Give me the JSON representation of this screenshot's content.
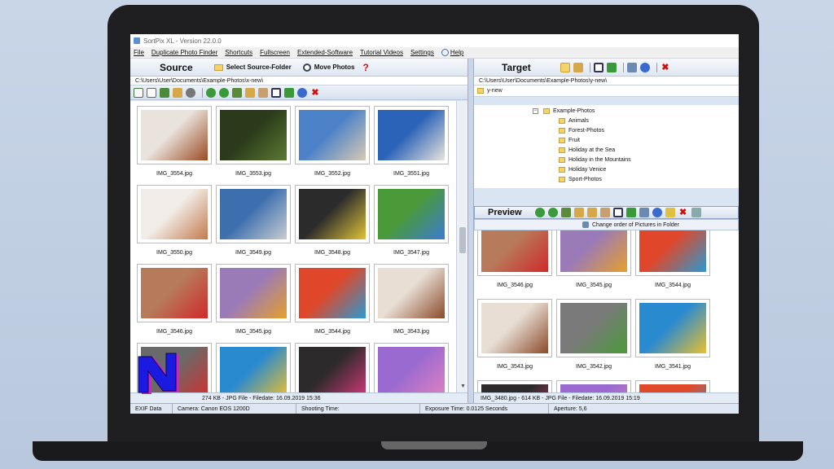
{
  "window": {
    "title": "SortPix XL - Version 22.0.0"
  },
  "menu": [
    "File",
    "Duplicate Photo Finder",
    "Shortcuts",
    "Fullscreen",
    "Extended-Software",
    "Tutorial Videos",
    "Settings",
    "Help"
  ],
  "source": {
    "title": "Source",
    "select_folder_label": "Select Source-Folder",
    "move_label": "Move Photos",
    "help_glyph": "?",
    "path": "C:\\Users\\User\\Documents\\Example-Photos\\x-new\\",
    "thumbnails": [
      {
        "label": "IMG_3554.jpg",
        "colors": [
          "#e9e3dc",
          "#9a4a22"
        ]
      },
      {
        "label": "IMG_3553.jpg",
        "colors": [
          "#2a3a1a",
          "#5c7a34"
        ]
      },
      {
        "label": "IMG_3552.jpg",
        "colors": [
          "#4c82c8",
          "#d8c9b2"
        ]
      },
      {
        "label": "IMG_3551.jpg",
        "colors": [
          "#2b63b8",
          "#e8e4dc"
        ]
      },
      {
        "label": "IMG_3550.jpg",
        "colors": [
          "#f2ede8",
          "#c37a4e"
        ]
      },
      {
        "label": "IMG_3549.jpg",
        "colors": [
          "#3d6fae",
          "#c9ccd2"
        ]
      },
      {
        "label": "IMG_3548.jpg",
        "colors": [
          "#2b2b2b",
          "#e0c438"
        ]
      },
      {
        "label": "IMG_3547.jpg",
        "colors": [
          "#4a9a3a",
          "#3c7bd0"
        ]
      },
      {
        "label": "IMG_3546.jpg",
        "colors": [
          "#b77a5a",
          "#d02a2a"
        ]
      },
      {
        "label": "IMG_3545.jpg",
        "colors": [
          "#9b7ab8",
          "#e5a02a"
        ]
      },
      {
        "label": "IMG_3544.jpg",
        "colors": [
          "#e0472a",
          "#2a9ad0"
        ]
      },
      {
        "label": "IMG_3543.jpg",
        "colors": [
          "#e8ded4",
          "#8a4a2a"
        ]
      },
      {
        "label": "",
        "colors": [
          "#6a6a6a",
          "#d03030"
        ]
      },
      {
        "label": "",
        "colors": [
          "#2a8ad0",
          "#e8c030"
        ]
      },
      {
        "label": "",
        "colors": [
          "#2c2a2a",
          "#d03a7a"
        ]
      },
      {
        "label": "",
        "colors": [
          "#9a6ad0",
          "#e080c0"
        ]
      }
    ],
    "status": "IMG_3554.jpg - 274 KB - JPG File - Filedate: 16.09.2019 15:36",
    "status_visible": "274 KB - JPG File - Filedate: 16.09.2019 15:36"
  },
  "target": {
    "title": "Target",
    "path": "C:\\Users\\User\\Documents\\Example-Photos\\y-new\\",
    "folder_field": "y-new",
    "tree_root": "Example-Photos",
    "tree_items": [
      "Animals",
      "Forest-Photos",
      "Fruit",
      "Holiday at the Sea",
      "Holiday in the Mountains",
      "Holiday Venice",
      "Sport-Photos"
    ],
    "status": "IMG_3480.jpg - 614 KB - JPG File - Filedate: 16.09.2019 15:19"
  },
  "preview": {
    "title": "Preview",
    "change_order_label": "Change order of Pictures in Folder",
    "thumbnails": [
      {
        "label": "IMG_3546.jpg",
        "colors": [
          "#b77a5a",
          "#d02a2a"
        ]
      },
      {
        "label": "IMG_3545.jpg",
        "colors": [
          "#9b7ab8",
          "#e5a02a"
        ]
      },
      {
        "label": "IMG_3544.jpg",
        "colors": [
          "#e0472a",
          "#2a9ad0"
        ]
      },
      {
        "label": "IMG_3543.jpg",
        "colors": [
          "#e8ded4",
          "#8a4a2a"
        ]
      },
      {
        "label": "IMG_3542.jpg",
        "colors": [
          "#7a7a7a",
          "#4a9a3a"
        ]
      },
      {
        "label": "IMG_3541.jpg",
        "colors": [
          "#2a8ad0",
          "#e8c030"
        ]
      },
      {
        "label": "",
        "colors": [
          "#2c2a2a",
          "#d03a7a"
        ]
      },
      {
        "label": "",
        "colors": [
          "#9a6ad0",
          "#e080c0"
        ]
      },
      {
        "label": "",
        "colors": [
          "#e04a2a",
          "#2a9ad0"
        ]
      }
    ]
  },
  "bottom_status": {
    "exif": "EXIF Data",
    "camera": "Camera: Canon EOS 1200D",
    "shooting_time": "Shooting Time:",
    "exposure": "Exposure Time: 0.0125 Seconds",
    "aperture": "Aperture: 5,6"
  },
  "colors": {
    "accent": "#d9e5f3",
    "close_red": "#d01010",
    "logo_blue": "#1a1ae0",
    "logo_magenta": "#d020d0"
  },
  "icons": [
    "app-icon",
    "folder-icon",
    "move-icon",
    "help-icon",
    "check-icon",
    "refresh-icon",
    "zoom-icon",
    "delete-icon"
  ]
}
